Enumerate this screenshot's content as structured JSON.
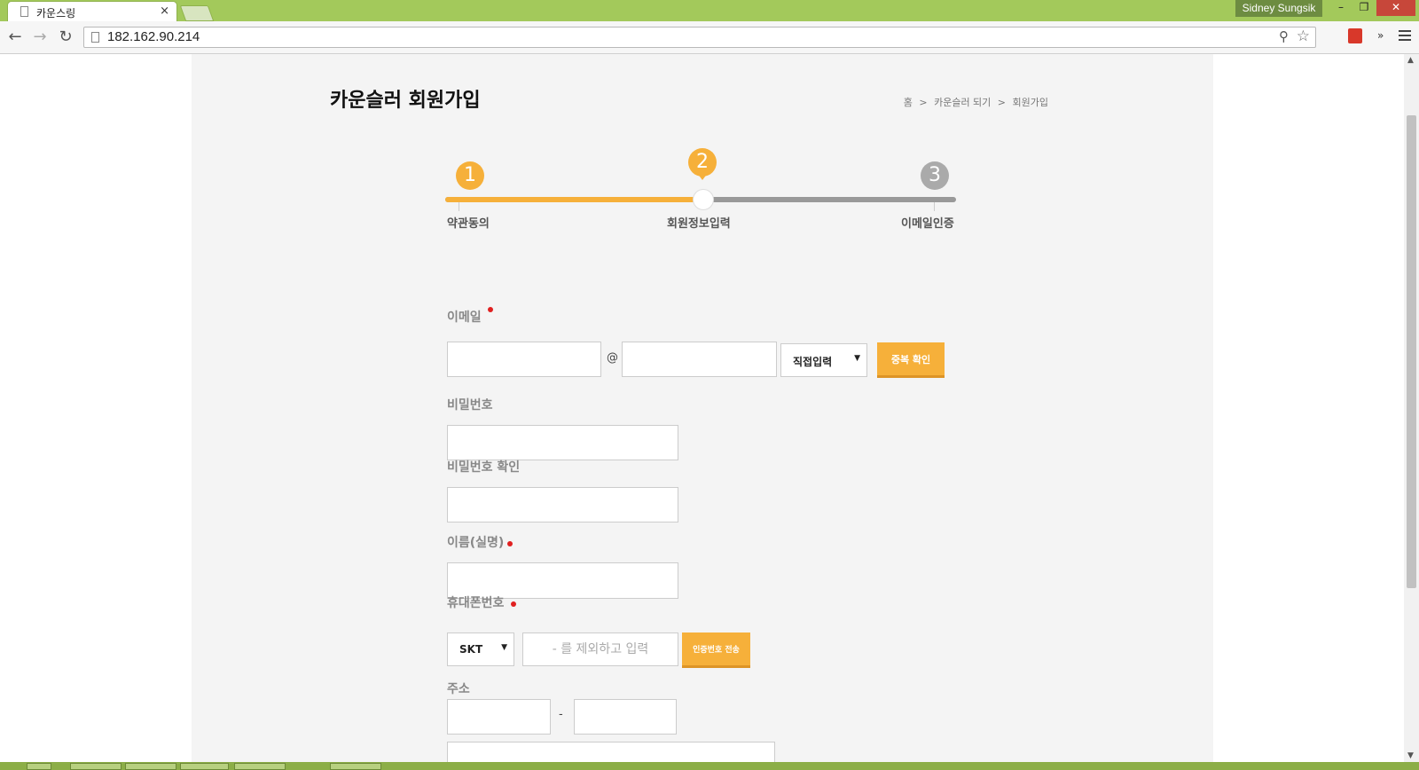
{
  "browser": {
    "tab_title": "카운스링",
    "tab_close": "×",
    "profile_name": "Sidney Sungsik",
    "url": "182.162.90.214",
    "window_min": "–",
    "window_max": "❐",
    "window_close": "✕"
  },
  "page": {
    "title": "카운슬러 회원가입",
    "breadcrumb": [
      "홈",
      "카운슬러 되기",
      "회원가입"
    ],
    "breadcrumb_sep": ">"
  },
  "steps": {
    "current": 2,
    "progress": 0.5,
    "items": [
      {
        "number": "1",
        "label": "약관동의"
      },
      {
        "number": "2",
        "label": "회원정보입력"
      },
      {
        "number": "3",
        "label": "이메일인증"
      }
    ]
  },
  "form": {
    "email": {
      "label": "이메일",
      "at": "@",
      "domain_select": "직접입력",
      "check_button": "중복 확인"
    },
    "password": {
      "label": "비밀번호"
    },
    "password_confirm": {
      "label": "비밀번호 확인"
    },
    "name": {
      "label": "이름(실명)"
    },
    "phone": {
      "label": "휴대폰번호",
      "carrier": "SKT",
      "placeholder": "- 를 제외하고 입력",
      "send_button": "인증번호 전송"
    },
    "address": {
      "label": "주소",
      "dash": "-"
    }
  },
  "colors": {
    "accent": "#f6b03a",
    "required": "#e02020",
    "chrome": "#a3c95b"
  }
}
